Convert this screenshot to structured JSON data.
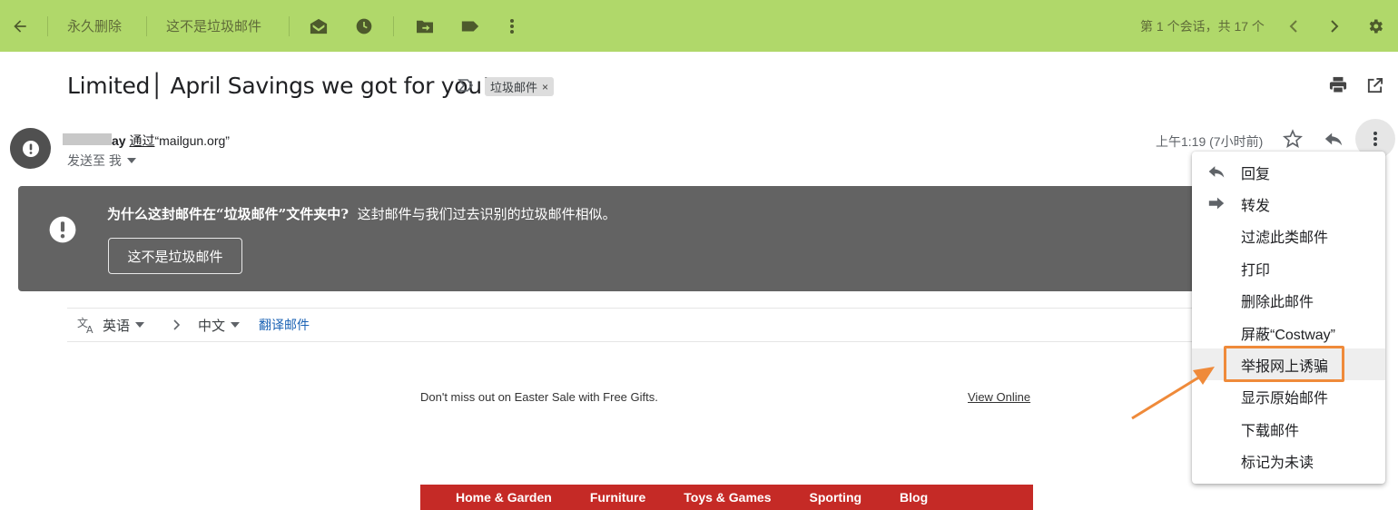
{
  "toolbar": {
    "back_icon": "arrow-left-icon",
    "delete_forever": "永久删除",
    "not_spam": "这不是垃圾邮件",
    "count_text": "第 1 个会话，共 17 个",
    "bg_color": "#b0d86a"
  },
  "message": {
    "subject": "Limited│ April Savings we got for you!",
    "label": "垃圾邮件",
    "label_remove": "×",
    "sender_name": "ay",
    "sender_via": "通过",
    "sender_domain": "“mailgun.org”",
    "to_text": "发送至 我",
    "time": "上午1:19 (7小时前)"
  },
  "spam_banner": {
    "heading": "为什么这封邮件在“垃圾邮件”文件夹中?",
    "reason": "这封邮件与我们过去识别的垃圾邮件相似。",
    "button": "这不是垃圾邮件"
  },
  "translate": {
    "from_lang": "英语",
    "to_lang": "中文",
    "action": "翻译邮件"
  },
  "email_body": {
    "tagline": "Don't miss out on Easter Sale with Free Gifts.",
    "view_online": "View Online",
    "nav": [
      "Home & Garden",
      "Furniture",
      "Toys & Games",
      "Sporting",
      "Blog"
    ],
    "nav_color": "#c52a26"
  },
  "menu": {
    "items": [
      {
        "label": "回复",
        "icon": "reply-icon"
      },
      {
        "label": "转发",
        "icon": "forward-icon"
      },
      {
        "label": "过滤此类邮件",
        "icon": ""
      },
      {
        "label": "打印",
        "icon": ""
      },
      {
        "label": "删除此邮件",
        "icon": ""
      },
      {
        "label": "屏蔽“Costway”",
        "icon": ""
      },
      {
        "label": "举报网上诱骗",
        "icon": ""
      },
      {
        "label": "显示原始邮件",
        "icon": ""
      },
      {
        "label": "下载邮件",
        "icon": ""
      },
      {
        "label": "标记为未读",
        "icon": ""
      }
    ],
    "highlighted": "举报网上诱骗",
    "highlight_color": "#ef8a3a"
  }
}
